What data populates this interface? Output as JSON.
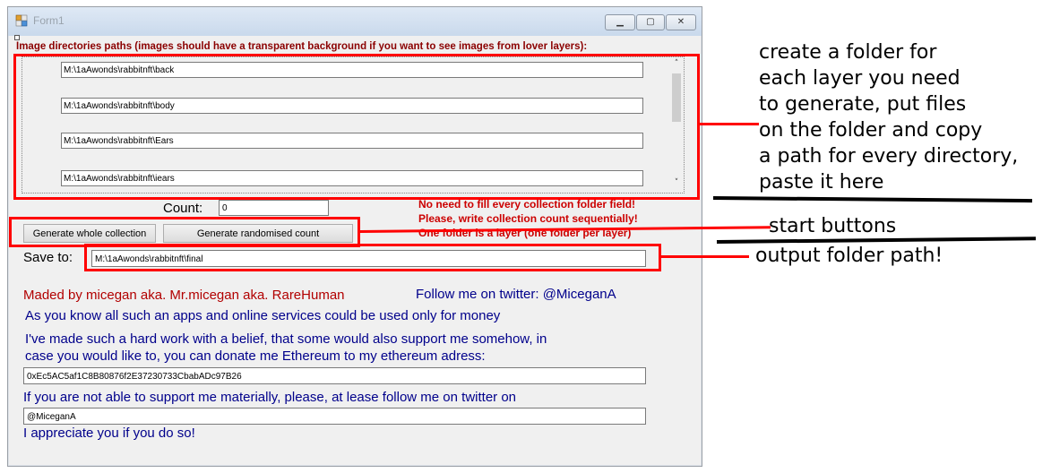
{
  "window": {
    "title": "Form1",
    "minimize_glyph": "▁",
    "maximize_glyph": "▢",
    "close_glyph": "✕"
  },
  "group": {
    "label": "Image directories paths (images should have a transparent background if you want to see images from lover layers):"
  },
  "paths": [
    "M:\\1aAwonds\\rabbitnft\\back",
    "M:\\1aAwonds\\rabbitnft\\body",
    "M:\\1aAwonds\\rabbitnft\\Ears",
    "M:\\1aAwonds\\rabbitnft\\iears"
  ],
  "scroll": {
    "up_glyph": "˄",
    "down_glyph": "˅"
  },
  "count": {
    "label": "Count:",
    "value": "0"
  },
  "note": {
    "line1": "No need to fill every collection folder field!",
    "line2": "Please, write collection count sequentially!",
    "line3": "One folder is a layer (one folder per layer)"
  },
  "buttons": {
    "generate_whole": "Generate whole collection",
    "generate_random": "Generate randomised count"
  },
  "save": {
    "label": "Save to:",
    "value": "M:\\1aAwonds\\rabbitnft\\final"
  },
  "info": {
    "author": "Maded by micegan aka. Mr.micegan aka. RareHuman",
    "follow": "Follow me on twitter: @MiceganA",
    "money": "As you know all such an apps and online services could be used only for money",
    "work_line1": "I've made such a hard work with a belief, that some would also support me somehow, in",
    "work_line2": "case you would like to, you can donate me Ethereum to my ethereum adress:",
    "eth_address": "0xEc5AC5af1C8B80876f2E37230733CbabADc97B26",
    "material": "If you are not able to support me materially, please, at lease follow me on twitter on",
    "twitter_handle": "@MiceganA",
    "appreciate": "I appreciate you if you do so!"
  },
  "annotations": {
    "folder_note": [
      "create a folder for",
      "each layer you need",
      "to generate, put files",
      "on the folder and copy",
      "a path for every directory,",
      "paste it here"
    ],
    "start_buttons": "start buttons",
    "output_folder": "output folder path!"
  },
  "colors": {
    "annotation_red": "#ff0000",
    "label_dark_red": "#8b0000",
    "note_red": "#cc0000",
    "info_blue": "#00008b"
  }
}
